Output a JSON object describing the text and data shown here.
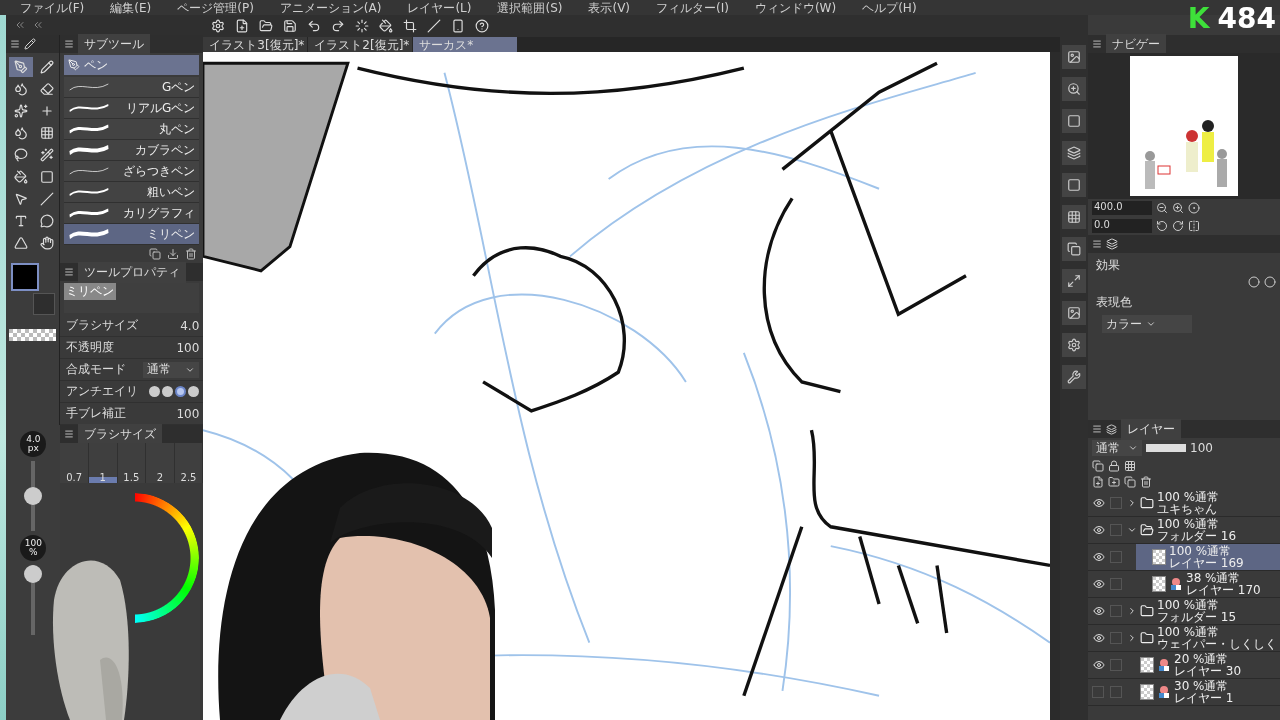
{
  "menu": [
    "ファイル(F)",
    "編集(E)",
    "ページ管理(P)",
    "アニメーション(A)",
    "レイヤー(L)",
    "選択範囲(S)",
    "表示(V)",
    "フィルター(I)",
    "ウィンドウ(W)",
    "ヘルプ(H)"
  ],
  "doc_tabs": [
    {
      "label": "イラスト3[復元]*",
      "selected": false
    },
    {
      "label": "イラスト2[復元]*",
      "selected": false
    },
    {
      "label": "サーカス*",
      "selected": true
    }
  ],
  "tools": [
    {
      "selected": true
    },
    {
      "selected": false
    },
    {
      "selected": false
    },
    {
      "selected": false
    },
    {
      "selected": false
    },
    {
      "selected": false
    },
    {
      "selected": false
    },
    {
      "selected": false
    },
    {
      "selected": false
    },
    {
      "selected": false
    },
    {
      "selected": false
    },
    {
      "selected": false
    },
    {
      "selected": false
    },
    {
      "selected": false
    },
    {
      "selected": false
    },
    {
      "selected": false
    },
    {
      "selected": false
    },
    {
      "selected": false
    }
  ],
  "subtool": {
    "tab": "サブツール",
    "group": "ペン",
    "brushes": [
      {
        "label": "Gペン",
        "selected": false
      },
      {
        "label": "リアルGペン",
        "selected": false
      },
      {
        "label": "丸ペン",
        "selected": false
      },
      {
        "label": "カブラペン",
        "selected": false
      },
      {
        "label": "ざらつきペン",
        "selected": false
      },
      {
        "label": "粗いペン",
        "selected": false
      },
      {
        "label": "カリグラフィ",
        "selected": false
      },
      {
        "label": "ミリペン",
        "selected": true
      }
    ]
  },
  "tool_property": {
    "tab": "ツールプロパティ",
    "preview_label": "ミリペン",
    "rows": [
      {
        "kind": "number",
        "label": "ブラシサイズ",
        "value": "4.0"
      },
      {
        "kind": "number",
        "label": "不透明度",
        "value": "100"
      },
      {
        "kind": "dropdown",
        "label": "合成モード",
        "value": "通常"
      },
      {
        "kind": "choice",
        "label": "アンチエイリ",
        "options": [
          {
            "selected": false
          },
          {
            "selected": false
          },
          {
            "selected": true
          },
          {
            "selected": false
          }
        ]
      },
      {
        "kind": "number",
        "label": "手ブレ補正",
        "value": "100"
      }
    ]
  },
  "brush_size": {
    "tab": "ブラシサイズ",
    "sizes": [
      {
        "label": "0.7",
        "selected": false
      },
      {
        "label": "1",
        "selected": true
      },
      {
        "label": "1.5",
        "selected": false
      },
      {
        "label": "2",
        "selected": false
      },
      {
        "label": "2.5",
        "selected": false
      }
    ]
  },
  "quick_sliders": [
    {
      "value": "4.0",
      "unit": "px",
      "level": 0.5
    },
    {
      "value": "100",
      "unit": "%",
      "level": 1
    }
  ],
  "navigator": {
    "tab": "ナビゲー",
    "zoom": "400.0",
    "rotation": "0.0"
  },
  "layer_property": {
    "effect_label": "効果",
    "color_label": "表現色",
    "color_mode": "カラー"
  },
  "layers_panel": {
    "tab": "レイヤー",
    "blend": "通常",
    "opacity": "100",
    "opacity_slider": {
      "level": 1
    },
    "layers": [
      {
        "kind": "folder",
        "blend": "100 %通常",
        "name": "ユキちゃん",
        "visible": true,
        "locked": false,
        "expanded": false,
        "selected": false
      },
      {
        "kind": "folder",
        "blend": "100 %通常",
        "name": "フォルダー 16",
        "visible": true,
        "locked": false,
        "expanded": true,
        "selected": false,
        "children": [
          {
            "kind": "layer",
            "blend": "100 %通常",
            "name": "レイヤー 169",
            "visible": true,
            "locked": false,
            "selected": true
          },
          {
            "kind": "raster",
            "blend": "38 %通常",
            "name": "レイヤー 170",
            "visible": true,
            "locked": false,
            "selected": false
          }
        ]
      },
      {
        "kind": "folder",
        "blend": "100 %通常",
        "name": "フォルダー 15",
        "visible": true,
        "locked": false,
        "expanded": false,
        "selected": false
      },
      {
        "kind": "folder",
        "blend": "100 %通常",
        "name": "ウェイパー・しくしく",
        "visible": true,
        "locked": false,
        "expanded": false,
        "selected": false
      },
      {
        "kind": "raster",
        "blend": "20 %通常",
        "name": "レイヤー 30",
        "visible": true,
        "locked": false,
        "selected": false
      },
      {
        "kind": "raster",
        "blend": "30 %通常",
        "name": "レイヤー 1",
        "visible": false,
        "locked": false,
        "selected": false
      }
    ]
  },
  "badge": {
    "logo": "K",
    "count": "484"
  }
}
